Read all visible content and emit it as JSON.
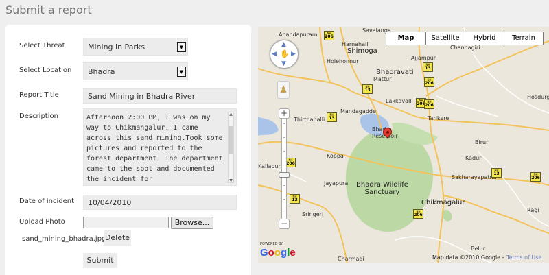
{
  "page": {
    "title": "Submit a report"
  },
  "form": {
    "threat": {
      "label": "Select Threat",
      "value": "Mining in Parks"
    },
    "location": {
      "label": "Select Location",
      "value": "Bhadra"
    },
    "report_title": {
      "label": "Report Title",
      "value": "Sand Mining in Bhadra River"
    },
    "description": {
      "label": "Description",
      "value": "Afternoon 2:00 PM, I was on my way to Chikmangalur. I came across this sand mining.Took some pictures and reported to the forest department. The department came to the spot and documented the incident for"
    },
    "date": {
      "label": "Date of incident",
      "value": "10/04/2010"
    },
    "photo": {
      "label": "Upload Photo",
      "browse_label": "Browse...",
      "filename": "sand_mining_bhadra.jpg",
      "delete_label": "Delete"
    },
    "submit_label": "Submit"
  },
  "map": {
    "types": [
      "Map",
      "Satellite",
      "Hybrid",
      "Terrain"
    ],
    "selected_type": "Map",
    "places": {
      "anandapuram": "Anandapuram",
      "savalanga": "Savalanga",
      "harnahalli": "Harnahalli",
      "shimoga": "Shimoga",
      "holehonnur": "Holehonnur",
      "ajjampur": "Ajjampur",
      "mattur": "Mattur",
      "bhadravati": "Bhadravati",
      "channagiri": "Channagiri",
      "hosdurga": "Hosdurga",
      "lakkavalli": "Lakkavalli",
      "mandagadde": "Mandagadde",
      "tarikere": "Tarikere",
      "thirthahalli": "Thirthahalli",
      "bhadra_reservoir": "Bhadra Reservoir",
      "koppa": "Koppa",
      "kadur": "Kadur",
      "birur": "Birur",
      "jayapura": "Jayapura",
      "sakharayapatna": "Sakharayapatna",
      "bhadra_sanctuary": "Bhadra Wildlife Sanctuary",
      "chikmagalur": "Chikmagalur",
      "sringeri": "Sringeri",
      "charmadi": "Charmadi",
      "belur": "Belur",
      "ragi": "Ragi",
      "kallapura": "Kallapura"
    },
    "highways": [
      "206",
      "13",
      "206",
      "13",
      "206",
      "13",
      "206",
      "13",
      "206",
      "13",
      "206",
      "206"
    ],
    "highway_prefix": "NH",
    "attribution": "Map data ©2010 Google -",
    "terms_label": "Terms of Use",
    "powered_by": "POWERED BY",
    "logo": "Google",
    "logo_colors": [
      "#3369e8",
      "#d50f25",
      "#eeb211",
      "#3369e8",
      "#009925",
      "#d50f25"
    ]
  }
}
